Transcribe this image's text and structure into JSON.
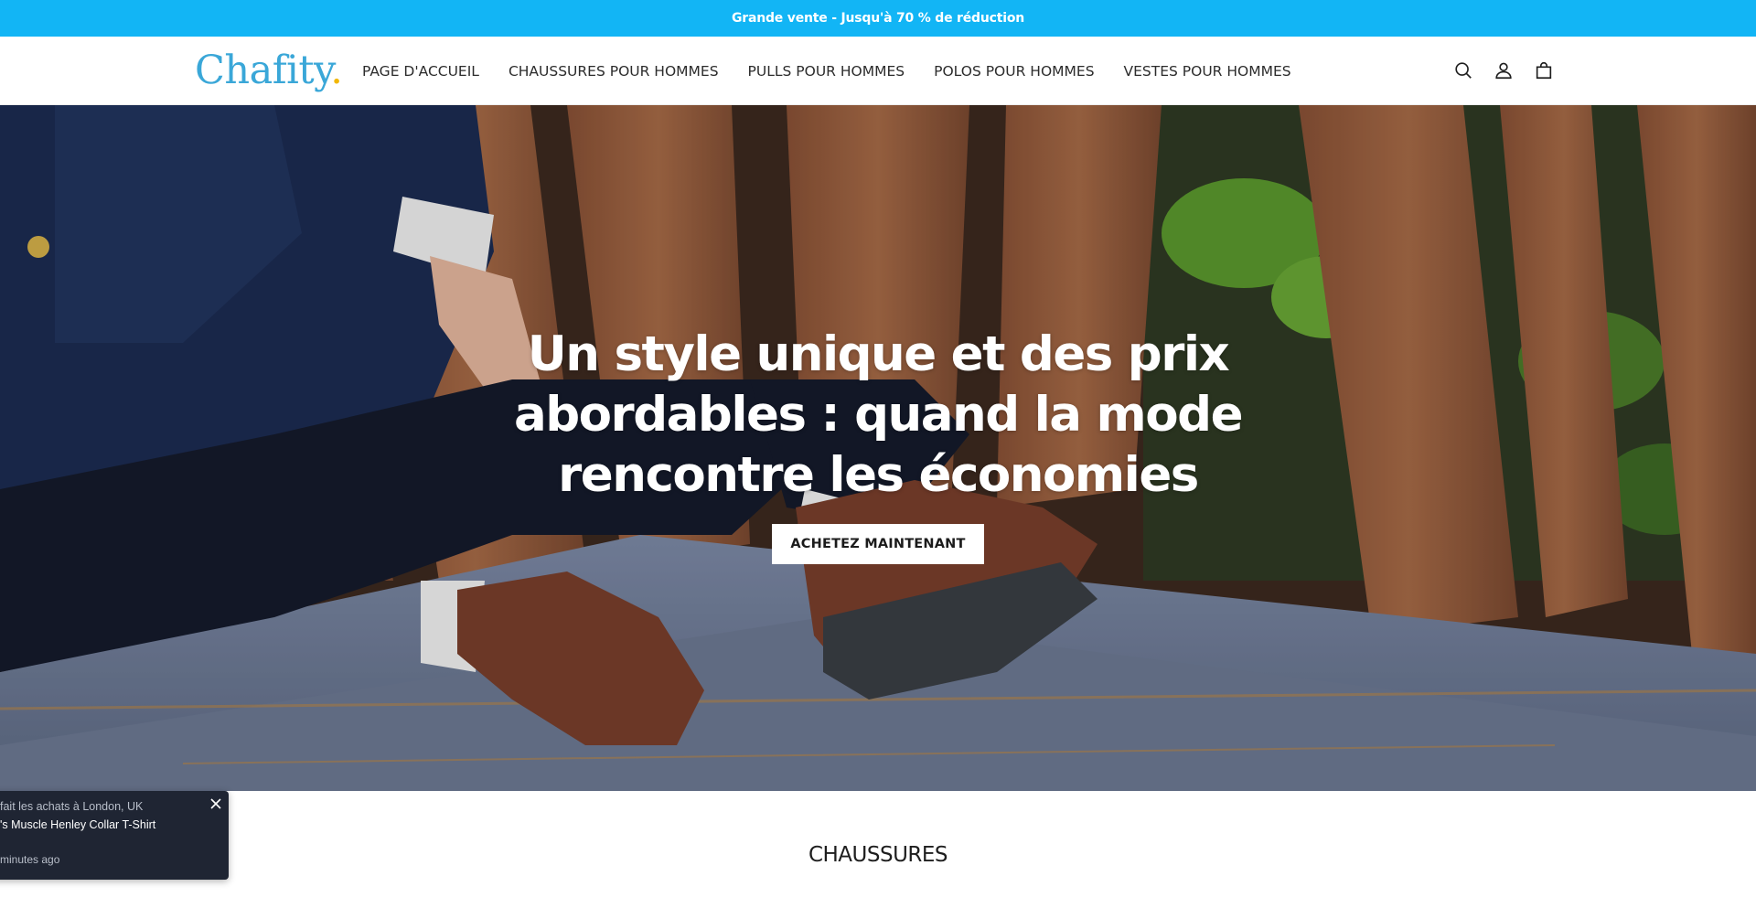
{
  "announcement": {
    "text": "Grande vente - Jusqu'à 70 % de réduction",
    "bg_color": "#12b5f5"
  },
  "header": {
    "logo_text": "Chafity",
    "logo_dot": ".",
    "nav": [
      {
        "label": "PAGE D'ACCUEIL"
      },
      {
        "label": "CHAUSSURES POUR HOMMES"
      },
      {
        "label": "PULLS POUR HOMMES"
      },
      {
        "label": "POLOS POUR HOMMES"
      },
      {
        "label": "VESTES POUR HOMMES"
      }
    ],
    "icons": [
      "search-icon",
      "account-icon",
      "cart-icon"
    ]
  },
  "hero": {
    "title": "Un style unique et des prix abordables : quand la mode rencontre les économies",
    "button_label": "ACHETEZ MAINTENANT"
  },
  "section": {
    "title": "CHAUSSURES"
  },
  "toast": {
    "line1": "fait les achats à London, UK",
    "line2": "'s Muscle Henley Collar T-Shirt",
    "line3": "minutes ago"
  },
  "colors": {
    "accent": "#12b5f5",
    "logo": "#3aa7d8",
    "logo_dot": "#f2b705",
    "toast_bg": "#1f2533"
  }
}
